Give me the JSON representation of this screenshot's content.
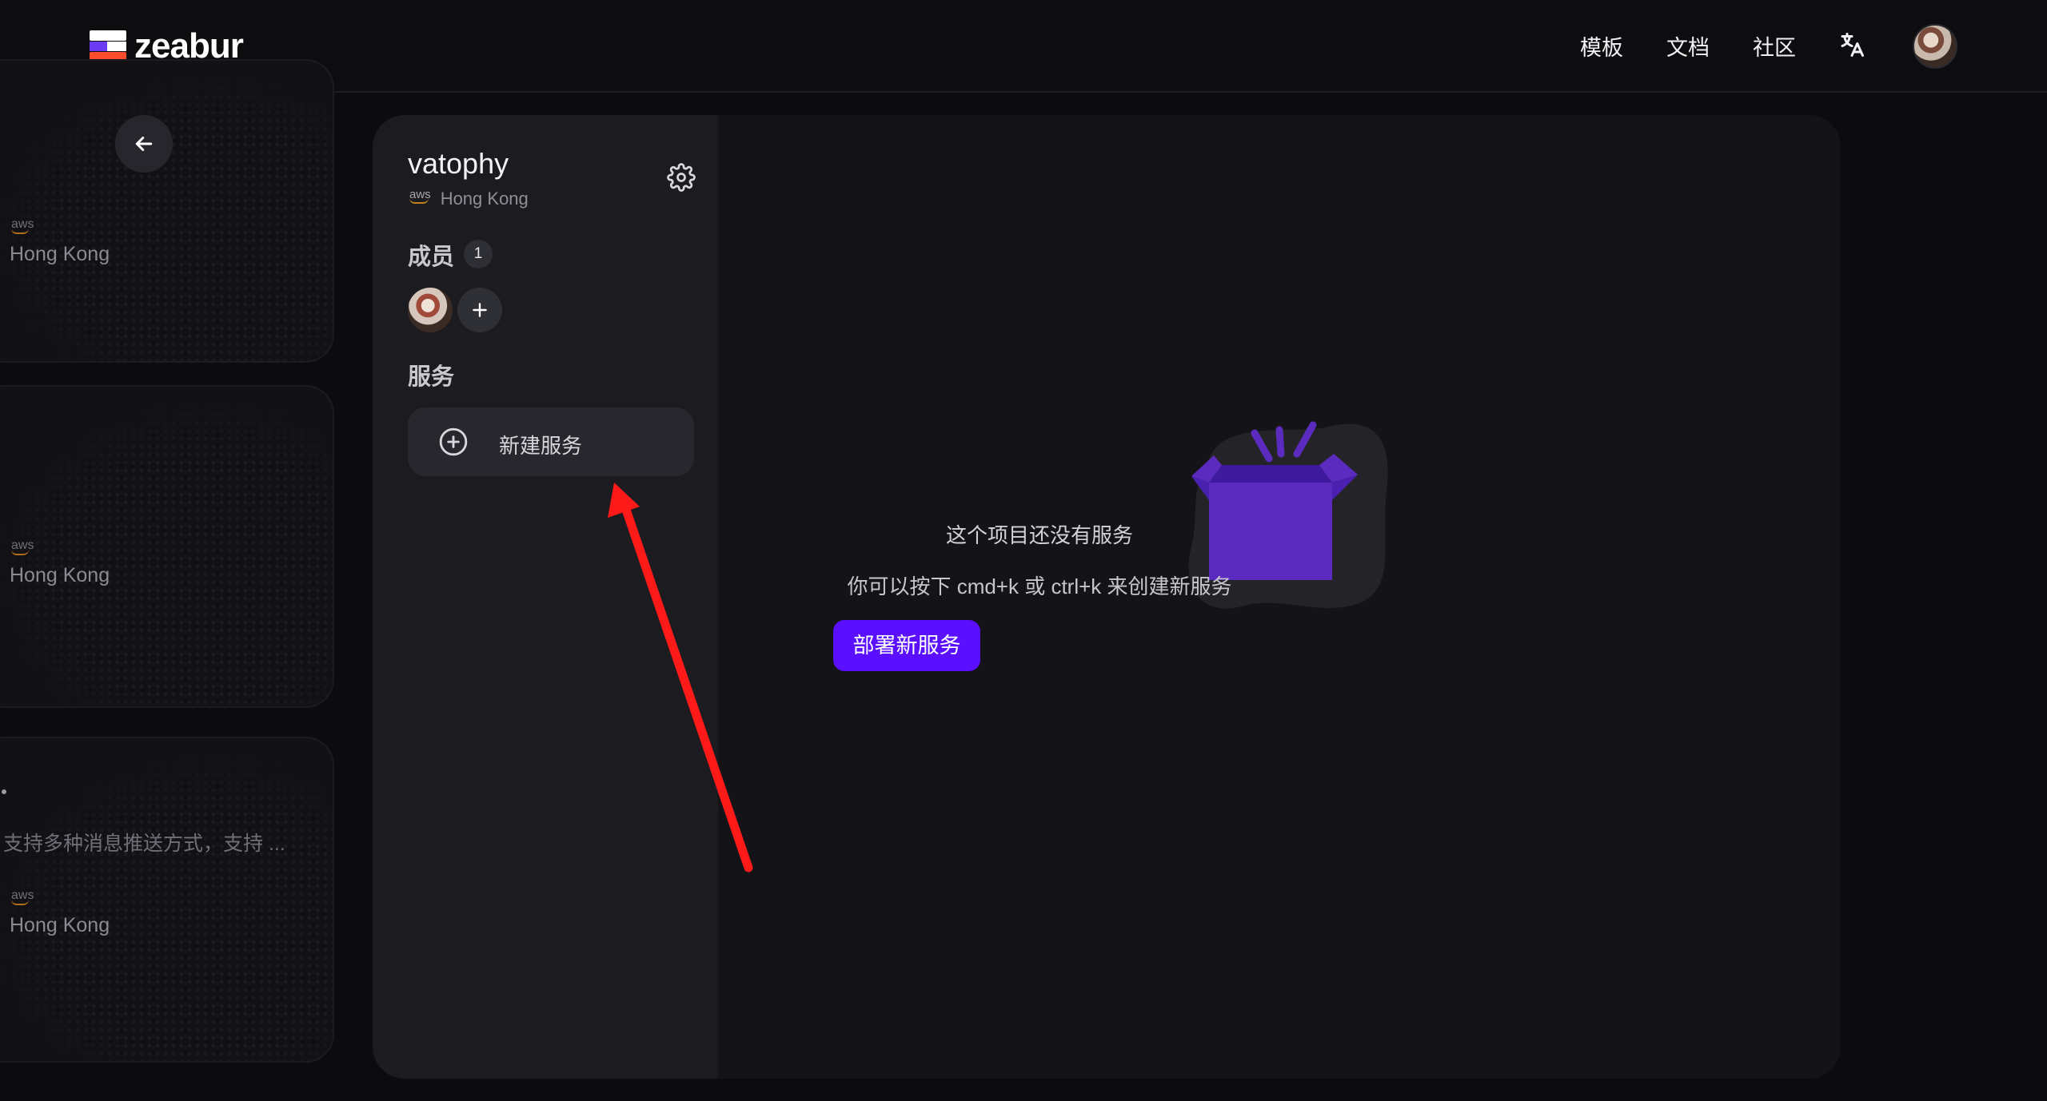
{
  "header": {
    "brand": "zeabur",
    "nav": [
      {
        "label": "模板"
      },
      {
        "label": "文档"
      },
      {
        "label": "社区"
      }
    ],
    "icons": [
      "translate-icon",
      "user-avatar"
    ]
  },
  "left_cards": [
    {
      "aws_label": "aws",
      "region": "Hong Kong"
    },
    {
      "aws_label": "aws",
      "region": "Hong Kong"
    },
    {
      "aws_label": "aws",
      "region": "Hong Kong",
      "description": "支持多种消息推送方式，支持 ..."
    }
  ],
  "project": {
    "name": "vatophy",
    "provider_label": "aws",
    "region": "Hong Kong"
  },
  "members": {
    "title": "成员",
    "count": "1"
  },
  "services": {
    "title": "服务",
    "new_service_label": "新建服务"
  },
  "empty_state": {
    "title": "这个项目还没有服务",
    "subtitle": "你可以按下 cmd+k 或 ctrl+k 来创建新服务",
    "cta": "部署新服务"
  },
  "colors": {
    "accent": "#5a10ff",
    "annotation_arrow": "#ff1a1a",
    "box_purple": "#5b2bc0"
  }
}
